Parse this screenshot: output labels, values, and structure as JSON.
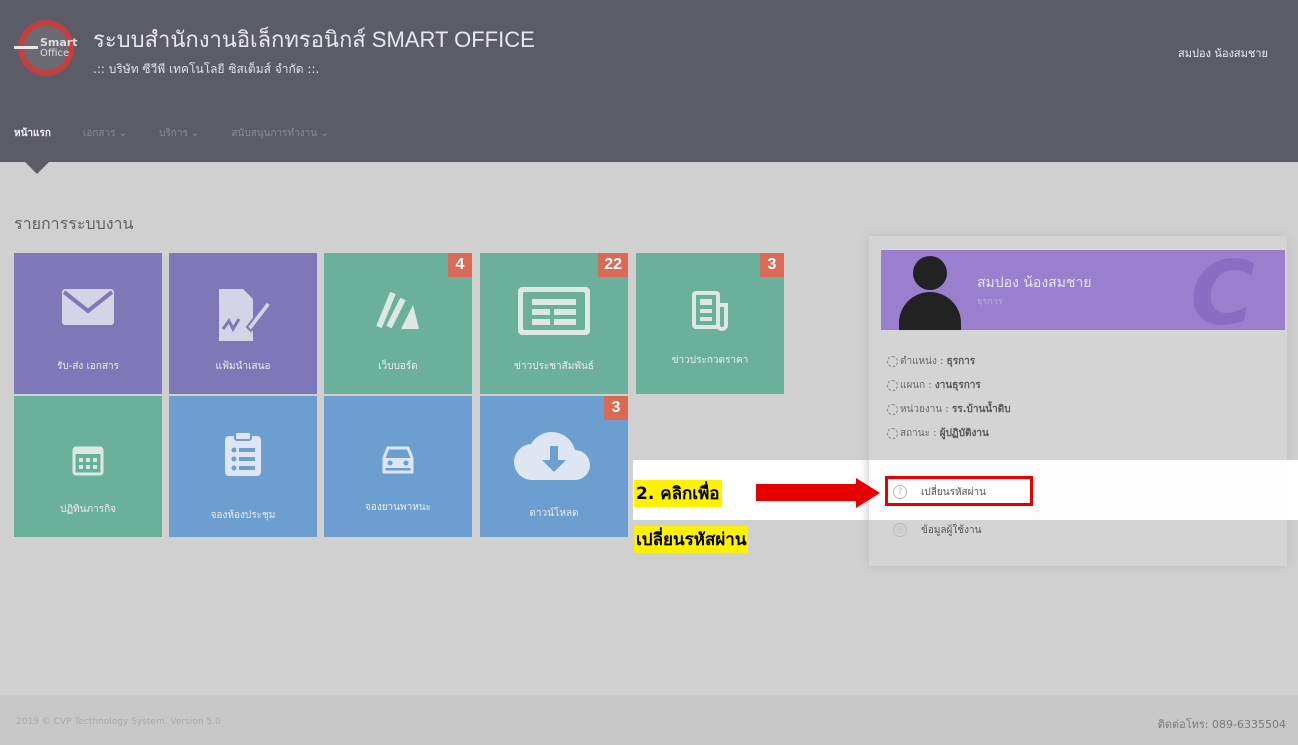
{
  "header": {
    "logo_text_1": "Smart",
    "logo_text_2": "Office",
    "title": "ระบบสำนักงานอิเล็กทรอนิกส์ SMART OFFICE",
    "subtitle": ".:: บริษัท ซีวีพี เทคโนโลยี ซิสเต็มส์ จำกัด ::.",
    "user": "สมปอง น้องสมชาย"
  },
  "nav": {
    "items": [
      {
        "label": "หน้าแรก"
      },
      {
        "label": "เอกสาร ⌄"
      },
      {
        "label": "บริการ ⌄"
      },
      {
        "label": "สนับสนุนการทำงาน ⌄"
      }
    ]
  },
  "section_title": "รายการระบบงาน",
  "tiles": [
    {
      "label": "รับ-ส่ง เอกสาร",
      "icon": "envelope-icon",
      "badge": ""
    },
    {
      "label": "แฟ้มนำเสนอ",
      "icon": "signature-icon",
      "badge": ""
    },
    {
      "label": "เว็บบอร์ด",
      "icon": "webboard-icon",
      "badge": "4"
    },
    {
      "label": "ข่าวประชาสัมพันธ์",
      "icon": "newspaper-icon",
      "badge": "22"
    },
    {
      "label": "ข่าวประกวดราคา",
      "icon": "news-icon",
      "badge": "3"
    },
    {
      "label": "ปฏิทินภารกิจ",
      "icon": "calendar-icon",
      "badge": ""
    },
    {
      "label": "จองห้องประชุม",
      "icon": "clipboard-icon",
      "badge": ""
    },
    {
      "label": "จองยานพาหนะ",
      "icon": "car-icon",
      "badge": ""
    },
    {
      "label": "ดาวน์โหลด",
      "icon": "cloud-download-icon",
      "badge": "3"
    }
  ],
  "profile": {
    "name": "สมปอง น้องสมชาย",
    "role": "ธุรการ",
    "info": [
      {
        "label": "ตำแหน่ง : ",
        "value": "ธุรการ"
      },
      {
        "label": "แผนก : ",
        "value": "งานธุรการ"
      },
      {
        "label": "หน่วยงาน : ",
        "value": "รร.บ้านน้ำดิบ"
      },
      {
        "label": "สถานะ : ",
        "value": "ผู้ปฏิบัติงาน"
      }
    ],
    "menu": [
      {
        "label": "เปลี่ยนรหัสผ่าน"
      },
      {
        "label": "ข้อมูลผู้ใช้งาน"
      }
    ]
  },
  "annotation": {
    "line1": "2. คลิกเพื่อ",
    "line2": "เปลี่ยนรหัสผ่าน"
  },
  "footer": {
    "left": "2019 © CVP Tecthnology System. Version 5.0",
    "right": "ติดต่อโทร: 089-6335504"
  },
  "colors": {
    "header_bg": "#5c5c66",
    "tile_purple": "#7f78b8",
    "tile_green": "#6bb09a",
    "tile_blue": "#6c9fd0",
    "badge": "#d96a55",
    "annotation_red": "#e60000",
    "annotation_yellow": "#fff200"
  }
}
